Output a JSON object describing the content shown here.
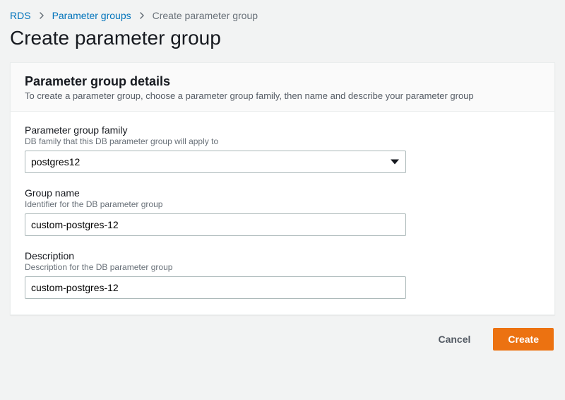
{
  "breadcrumb": {
    "items": [
      {
        "label": "RDS"
      },
      {
        "label": "Parameter groups"
      }
    ],
    "current": "Create parameter group"
  },
  "page_title": "Create parameter group",
  "panel": {
    "title": "Parameter group details",
    "subtitle": "To create a parameter group, choose a parameter group family, then name and describe your parameter group"
  },
  "fields": {
    "family": {
      "label": "Parameter group family",
      "hint": "DB family that this DB parameter group will apply to",
      "value": "postgres12"
    },
    "group_name": {
      "label": "Group name",
      "hint": "Identifier for the DB parameter group",
      "value": "custom-postgres-12"
    },
    "description": {
      "label": "Description",
      "hint": "Description for the DB parameter group",
      "value": "custom-postgres-12"
    }
  },
  "actions": {
    "cancel": "Cancel",
    "create": "Create"
  }
}
